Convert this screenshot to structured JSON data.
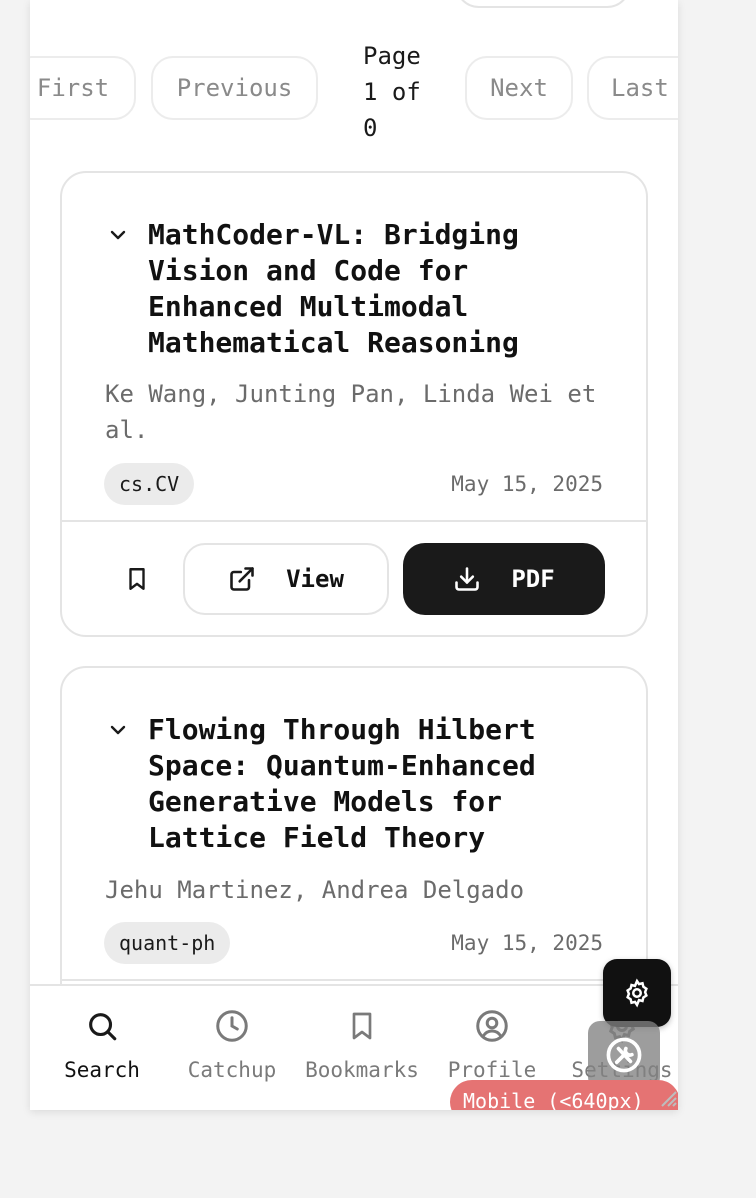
{
  "pagination": {
    "first_label": "First",
    "previous_label": "Previous",
    "info": "Page\n1 of\n0",
    "next_label": "Next",
    "last_label": "Last"
  },
  "papers": [
    {
      "title": "MathCoder-VL: Bridging Vision and Code for Enhanced Multimodal Mathematical Reasoning",
      "authors": "Ke Wang, Junting Pan, Linda Wei et al.",
      "category": "cs.CV",
      "date": "May 15, 2025",
      "view_label": "View",
      "pdf_label": "PDF"
    },
    {
      "title": "Flowing Through Hilbert Space: Quantum-Enhanced Generative Models for Lattice Field Theory",
      "authors": "Jehu Martinez, Andrea Delgado",
      "category": "quant-ph",
      "date": "May 15, 2025"
    }
  ],
  "bottom_nav": [
    {
      "label": "Search",
      "icon": "search-icon",
      "active": true
    },
    {
      "label": "Catchup",
      "icon": "clock-icon",
      "active": false
    },
    {
      "label": "Bookmarks",
      "icon": "bookmark-icon",
      "active": false
    },
    {
      "label": "Profile",
      "icon": "user-circle-icon",
      "active": false
    },
    {
      "label": "Settings",
      "icon": "gear-icon",
      "active": false
    }
  ],
  "breakpoint_badge": "Mobile (<640px)",
  "colors": {
    "primary": "#1a1a1a",
    "badge": "#e57373",
    "muted_text": "#6b6b6b",
    "tag_bg": "#ebebeb"
  }
}
